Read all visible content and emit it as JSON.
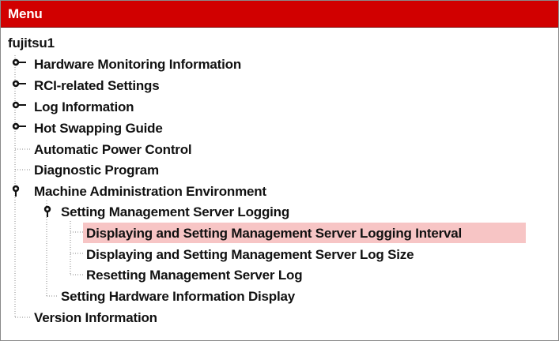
{
  "menu": {
    "title": "Menu"
  },
  "tree": {
    "root": "fujitsu1",
    "items": [
      "Hardware Monitoring Information",
      "RCI-related Settings",
      "Log Information",
      "Hot Swapping Guide",
      "Automatic Power Control",
      "Diagnostic Program",
      "Machine Administration Environment",
      "Setting Management Server Logging",
      "Displaying and Setting Management Server Logging Interval",
      "Displaying and Setting Management Server Log Size",
      "Resetting Management Server Log",
      "Setting Hardware Information Display",
      "Version Information"
    ]
  },
  "colors": {
    "header_bg": "#d10000",
    "header_text": "#ffffff",
    "selection_bg": "#f7c5c5",
    "tree_text": "#111111"
  },
  "icons": {
    "collapsed_toggle": "collapsed-node-icon",
    "expanded_toggle": "expanded-node-icon"
  }
}
